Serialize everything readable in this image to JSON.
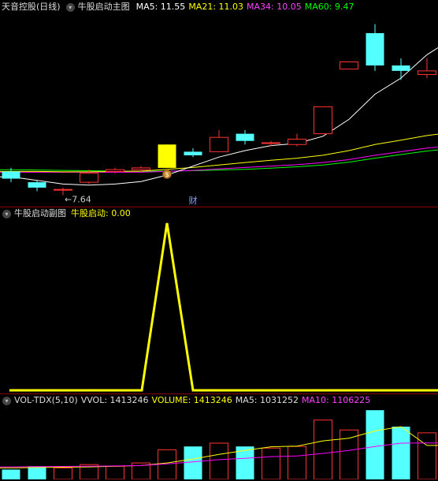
{
  "header": {
    "stock_name": "天音控股(日线)",
    "indicator_name": "牛股启动主图",
    "ma5": "MA5: 11.55",
    "ma21": "MA21: 11.03",
    "ma34": "MA34: 10.05",
    "ma60": "MA60: 9.47"
  },
  "sub_header": {
    "indicator_name": "牛股启动副图",
    "series_label": "牛股启动: 0.00"
  },
  "vol_header": {
    "indicator_name": "VOL-TDX(5,10)",
    "vvol": "VVOL: 1413246",
    "volume": "VOLUME: 1413246",
    "ma5": "MA5: 1031252",
    "ma10": "MA10: 1106225"
  },
  "annotations": {
    "low_marker": "←7.64",
    "cai_label": "财",
    "signal_icon": "$"
  },
  "colors": {
    "up": "#ff3232",
    "down": "#54ffff",
    "signal": "#ffff00",
    "ma5": "#ffffff",
    "ma21": "#ffff00",
    "ma34": "#ff00ff",
    "ma60": "#00ff00",
    "vol_ma10": "#ff00ff",
    "separator": "#8a0000"
  },
  "chart_data": [
    {
      "type": "candlestick",
      "ylim": [
        7.3,
        12.7
      ],
      "candles": [
        {
          "o": 8.3,
          "c": 8.1,
          "h": 8.4,
          "l": 8.0
        },
        {
          "o": 8.0,
          "c": 7.85,
          "h": 8.05,
          "l": 7.75
        },
        {
          "o": 7.8,
          "c": 7.8,
          "h": 7.85,
          "l": 7.64
        },
        {
          "o": 8.0,
          "c": 8.25,
          "h": 8.35,
          "l": 7.95
        },
        {
          "o": 8.3,
          "c": 8.35,
          "h": 8.4,
          "l": 8.25
        },
        {
          "o": 8.35,
          "c": 8.4,
          "h": 8.45,
          "l": 8.3
        },
        {
          "o": 8.4,
          "c": 9.05,
          "h": 9.05,
          "l": 8.4
        },
        {
          "o": 8.85,
          "c": 8.75,
          "h": 8.95,
          "l": 8.7
        },
        {
          "o": 8.85,
          "c": 9.25,
          "h": 9.45,
          "l": 8.85
        },
        {
          "o": 9.35,
          "c": 9.15,
          "h": 9.45,
          "l": 9.05
        },
        {
          "o": 9.1,
          "c": 9.1,
          "h": 9.15,
          "l": 9.0
        },
        {
          "o": 9.05,
          "c": 9.2,
          "h": 9.35,
          "l": 9.0
        },
        {
          "o": 9.35,
          "c": 10.1,
          "h": 10.1,
          "l": 9.35
        },
        {
          "o": 11.15,
          "c": 11.35,
          "h": 11.35,
          "l": 11.15
        },
        {
          "o": 12.15,
          "c": 11.25,
          "h": 12.4,
          "l": 11.1
        },
        {
          "o": 11.25,
          "c": 11.1,
          "h": 11.45,
          "l": 10.85
        },
        {
          "o": 11.0,
          "c": 11.1,
          "h": 11.45,
          "l": 10.9
        }
      ],
      "ma_lines": [
        {
          "name": "MA5",
          "values": [
            8.15,
            8.05,
            7.95,
            7.92,
            7.95,
            8.02,
            8.2,
            8.45,
            8.7,
            8.88,
            9.02,
            9.08,
            9.28,
            9.75,
            10.45,
            10.9,
            11.55
          ]
        },
        {
          "name": "MA21",
          "values": [
            8.3,
            8.3,
            8.29,
            8.29,
            8.3,
            8.31,
            8.36,
            8.41,
            8.48,
            8.55,
            8.61,
            8.67,
            8.75,
            8.88,
            9.05,
            9.17,
            9.3
          ]
        },
        {
          "name": "MA34",
          "values": [
            8.28,
            8.28,
            8.28,
            8.28,
            8.28,
            8.28,
            8.3,
            8.33,
            8.37,
            8.41,
            8.45,
            8.49,
            8.55,
            8.63,
            8.75,
            8.85,
            8.95
          ]
        },
        {
          "name": "MA60",
          "values": [
            8.35,
            8.34,
            8.33,
            8.32,
            8.31,
            8.3,
            8.31,
            8.32,
            8.34,
            8.36,
            8.39,
            8.43,
            8.48,
            8.56,
            8.67,
            8.77,
            8.87
          ]
        }
      ]
    },
    {
      "type": "line",
      "series": [
        {
          "name": "牛股启动",
          "values": [
            0,
            0,
            0,
            0,
            0,
            0,
            1,
            0,
            0,
            0,
            0,
            0,
            0,
            0,
            0,
            0,
            0
          ]
        }
      ],
      "ylim": [
        0,
        1
      ]
    },
    {
      "type": "bar",
      "ylim": [
        0,
        2200000
      ],
      "values": [
        300000,
        400000,
        350000,
        450000,
        400000,
        500000,
        900000,
        1000000,
        1100000,
        1000000,
        950000,
        1000000,
        1800000,
        1500000,
        2100000,
        1600000,
        1413246
      ],
      "ma_lines": [
        {
          "name": "MA5",
          "values": [
            350000,
            360000,
            370000,
            380000,
            400000,
            420000,
            500000,
            620000,
            760000,
            880000,
            990000,
            1010000,
            1170000,
            1250000,
            1470000,
            1600000,
            1031252
          ]
        },
        {
          "name": "MA10",
          "values": [
            380000,
            390000,
            395000,
            400000,
            410000,
            420000,
            470000,
            530000,
            600000,
            640000,
            690000,
            710000,
            790000,
            880000,
            1000000,
            1100000,
            1106225
          ]
        }
      ]
    }
  ]
}
